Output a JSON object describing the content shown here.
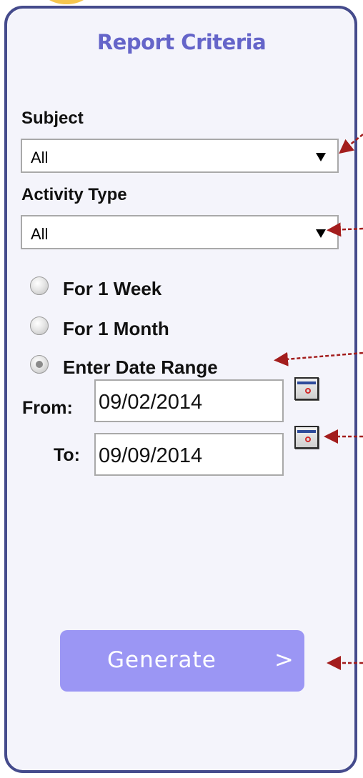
{
  "panel": {
    "title": "Report Criteria",
    "border_color": "#454b8c",
    "background": "#f4f4fb"
  },
  "subject": {
    "label": "Subject",
    "value": "All"
  },
  "activity_type": {
    "label": "Activity Type",
    "value": "All"
  },
  "range_options": [
    {
      "label": "For 1 Week",
      "checked": false
    },
    {
      "label": "For 1 Month",
      "checked": false
    },
    {
      "label": "Enter Date Range",
      "checked": true
    }
  ],
  "date_range": {
    "from_label": "From:",
    "from_value": "09/02/2014",
    "to_label": "To:",
    "to_value": "09/09/2014"
  },
  "generate": {
    "label": "Generate",
    "chevron": ">",
    "color": "#9b96f4"
  },
  "annotation_color": "#a31d1d"
}
